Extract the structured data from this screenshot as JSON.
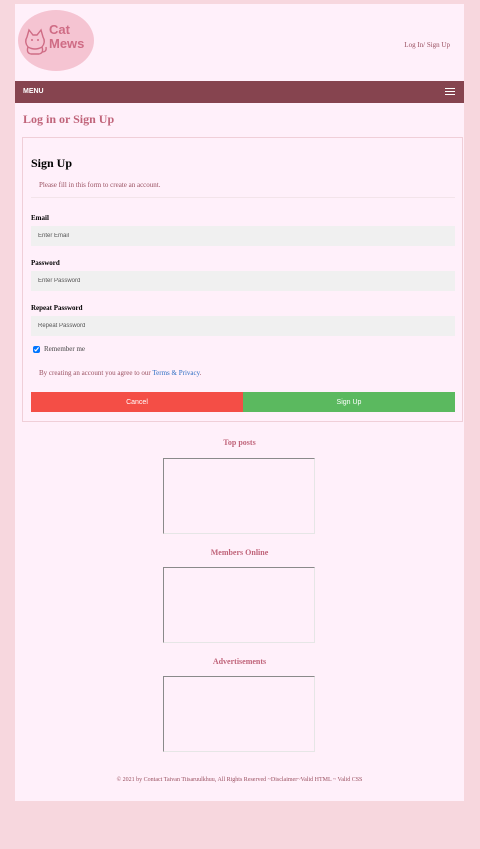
{
  "brand": {
    "name_line1": "Cat",
    "name_line2": "Mews"
  },
  "header": {
    "login_link": "Log In/ Sign Up"
  },
  "nav": {
    "menu_label": "MENU"
  },
  "page": {
    "title": "Log in or Sign Up"
  },
  "form": {
    "title": "Sign Up",
    "subtitle": "Please fill in this form to create an account.",
    "email_label": "Email",
    "email_placeholder": "Enter Email",
    "password_label": "Password",
    "password_placeholder": "Enter Password",
    "repeat_label": "Repeat Password",
    "repeat_placeholder": "Repeat Password",
    "remember_label": "Remember me",
    "remember_checked": true,
    "agree_text": "By creating an account you agree to our ",
    "terms_link": "Terms & Privacy",
    "agree_end": ".",
    "cancel_label": "Cancel",
    "signup_label": "Sign Up"
  },
  "sidebar": {
    "top_posts": "Top posts",
    "members_online": "Members Online",
    "advertisements": "Advertisements"
  },
  "footer": {
    "text": "© 2021 by Contact Taivan Tiisaruulkhuu, All Rights Reserved ~Disclaimer~Valid HTML ~ Valid CSS"
  },
  "colors": {
    "background": "#f7d7de",
    "panel": "#fff0fa",
    "nav": "#86444f",
    "accent": "#c0647a",
    "cancel": "#f44e46",
    "signup": "#5bb95f",
    "link": "#2f6fc4"
  },
  "icons": {
    "logo": "cat-logo-icon",
    "menu": "hamburger-menu-icon"
  }
}
